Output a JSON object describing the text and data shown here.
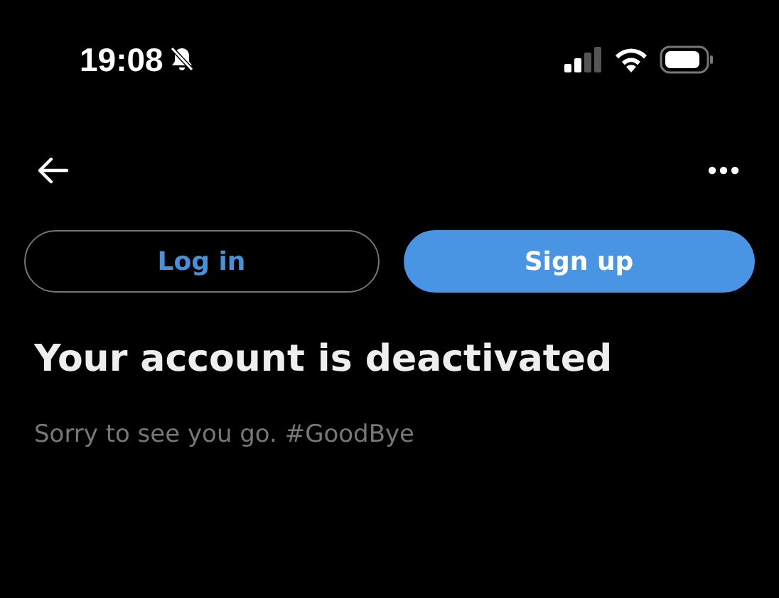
{
  "status_bar": {
    "time": "19:08"
  },
  "buttons": [
    {
      "label": "Log in",
      "kind": "outline"
    },
    {
      "label": "Sign up",
      "kind": "filled"
    }
  ],
  "title": "Your account is deactivated",
  "message": "Sorry to see you go. #GoodBye"
}
